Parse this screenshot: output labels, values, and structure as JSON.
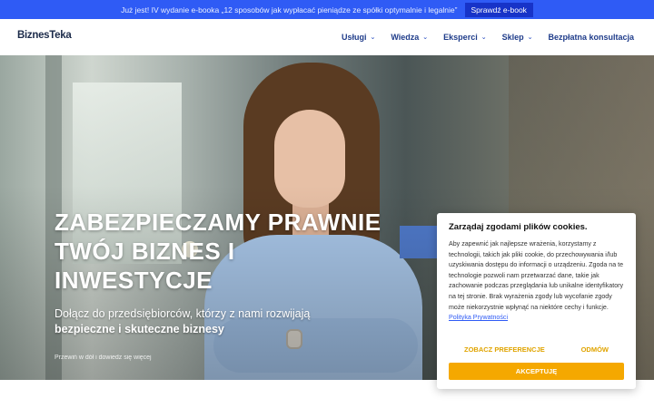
{
  "promo": {
    "text": "Już jest! IV wydanie e-booka „12 sposobów jak wypłacać pieniądze ze spółki optymalnie i legalnie”",
    "button": "Sprawdź e-book"
  },
  "header": {
    "logo": "BiznesTeka",
    "nav": [
      {
        "label": "Usługi",
        "icon": "chevron-down-icon"
      },
      {
        "label": "Wiedza",
        "icon": "chevron-down-icon"
      },
      {
        "label": "Eksperci",
        "icon": "chevron-down-icon"
      },
      {
        "label": "Sklep",
        "icon": "chevron-down-icon"
      },
      {
        "label": "Bezpłatna konsultacja"
      }
    ]
  },
  "hero": {
    "title_lines": [
      "ZABEZPIECZAMY PRAWNIE",
      "TWÓJ BIZNES I",
      "INWESTYCJE"
    ],
    "subtitle_line1": "Dołącz do przedsiębiorców, którzy z nami rozwijają",
    "subtitle_line2": "bezpieczne i skuteczne biznesy",
    "scroll_hint": "Przewiń w dół i dowiedz się więcej"
  },
  "cookie": {
    "title": "Zarządaj zgodami plików cookies.",
    "body": "Aby zapewnić jak najlepsze wrażenia, korzystamy z technologii, takich jak pliki cookie, do przechowywania i/lub uzyskiwania dostępu do informacji o urządzeniu. Zgoda na te technologie pozwoli nam przetwarzać dane, takie jak zachowanie podczas przeglądania lub unikalne identyfikatory na tej stronie. Brak wyrażenia zgody lub wycofanie zgody może niekorzystnie wpłynąć na niektóre cechy i funkcje.",
    "link": "Polityka Prywatności",
    "preferences": "ZOBACZ PREFERENCJE",
    "deny": "ODMÓW",
    "accept": "AKCEPTUJĘ"
  },
  "colors": {
    "promo_bg": "#2f5bf5",
    "nav_text": "#1f3c8a",
    "accent_yellow": "#f5a800"
  }
}
